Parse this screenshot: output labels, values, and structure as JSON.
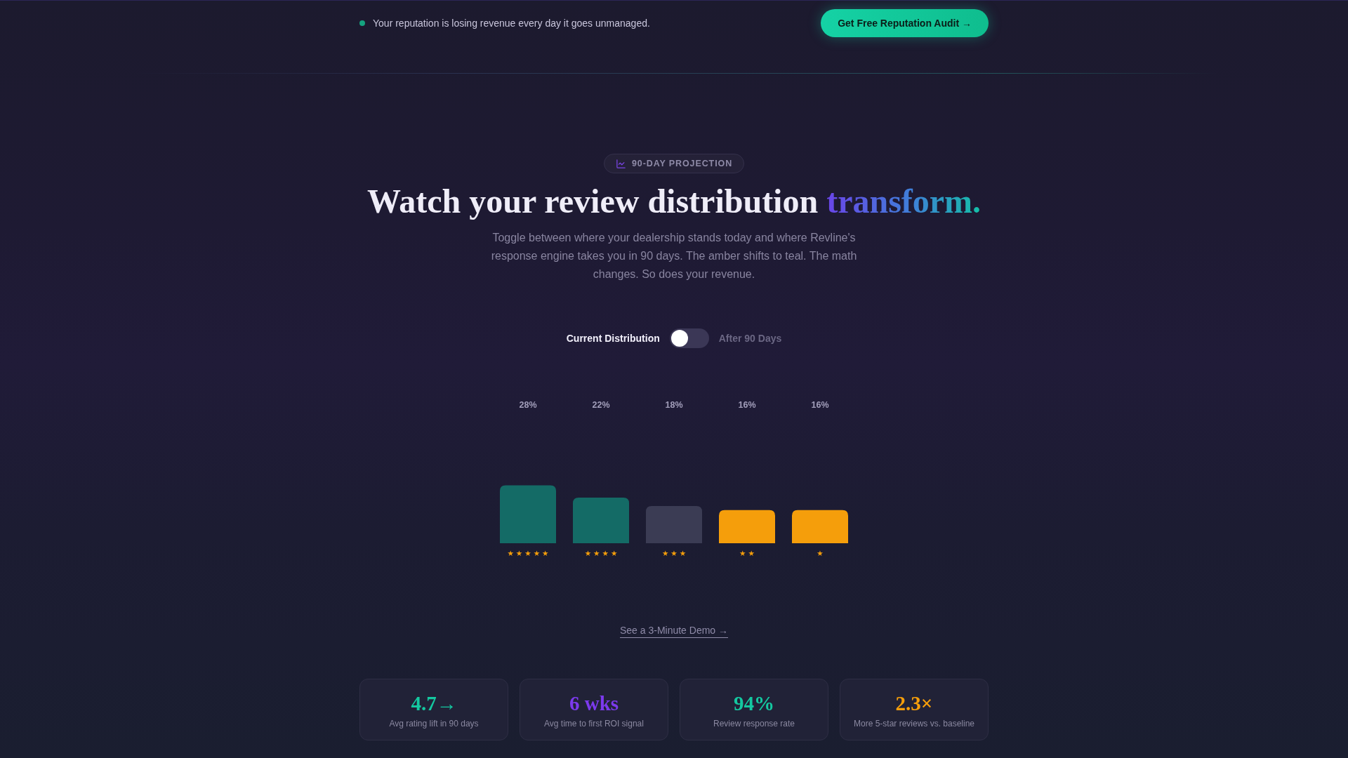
{
  "top_bar": {
    "notice": "Your reputation is losing revenue every day it goes unmanaged.",
    "cta": "Get Free Reputation Audit →"
  },
  "hero": {
    "badge": "90-DAY PROJECTION",
    "title": "Watch your review distribution",
    "title_highlight": "transform.",
    "subtitle": "Toggle between where your dealership stands today and where Revline's response engine takes you in 90 days. The amber shifts to teal. The math changes. So does your revenue."
  },
  "distribution_toggle": {
    "left_label": "Current Distribution",
    "right_label": "After 90 Days",
    "on": false
  },
  "distribution": {
    "chart_data": [
      {
        "type": "bar",
        "categories": [
          "★★★★★",
          "★★★★",
          "★★★",
          "★★",
          "★"
        ],
        "values": [
          28,
          22,
          18,
          16,
          16
        ],
        "colors": [
          "#146b66",
          "#146b66",
          "#3b3c54",
          "#f59e0b",
          "#f59e0b"
        ],
        "value_labels": [
          "28%",
          "22%",
          "18%",
          "16%",
          "16%"
        ]
      }
    ]
  },
  "demo_link": "See a 3-Minute Demo →",
  "stats": [
    {
      "value": "4.7→",
      "label": "Avg rating lift in 90 days",
      "color": "#14c8a0"
    },
    {
      "value": "6 wks",
      "label": "Avg time to first ROI signal",
      "color": "#7c3aed"
    },
    {
      "value": "94%",
      "label": "Review response rate",
      "color": "#14c8a0"
    },
    {
      "value": "2.3×",
      "label": "More 5-star reviews vs. baseline",
      "color": "#f59e0b"
    }
  ]
}
